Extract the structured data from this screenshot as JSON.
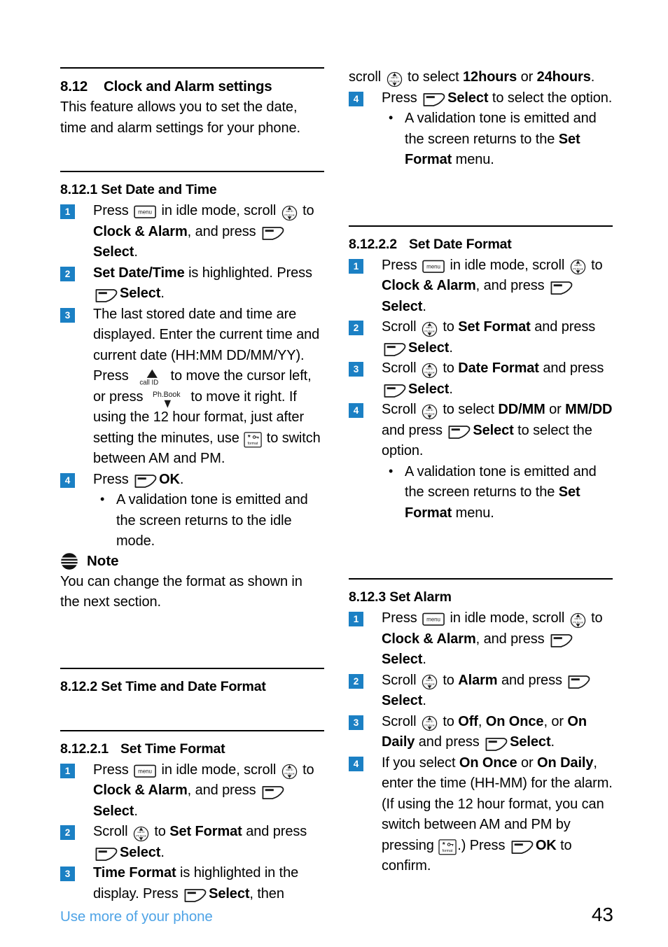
{
  "page": {
    "number": "43",
    "footer_text": "Use more of your phone"
  },
  "icons": {
    "menu_key": "menu-key-icon",
    "menu_key_label": "menu",
    "soft_key": "soft-key-icon",
    "nav_key": "navigation-key-icon",
    "nav_key_top_label": "call ID",
    "nav_key_bottom_label": "Ph.Book",
    "format_key": "format-key-icon",
    "format_key_label": "format",
    "callid_key": "call-id-key-icon",
    "callid_key_label": "call ID",
    "phbook_key": "phonebook-key-icon",
    "phbook_key_label": "Ph.Book",
    "note_icon": "note-icon"
  },
  "colors": {
    "badge_blue": "#1b80c4",
    "footer_blue": "#4ea3e6"
  },
  "left_column": {
    "section": {
      "number": "8.12",
      "title": "Clock and Alarm settings",
      "intro": "This feature allows you to set the date, time and alarm settings for your phone."
    },
    "sub1": {
      "number": "8.12.1",
      "title": "Set Date and Time",
      "steps": {
        "s1_a": "Press ",
        "s1_b": " in idle mode, scroll ",
        "s1_c": " to ",
        "s1_bold1": "Clock & Alarm",
        "s1_d": ", and press ",
        "s1_bold2": "Select",
        "s1_e": ".",
        "s2_bold1": "Set Date/Time",
        "s2_a": " is highlighted. Press ",
        "s2_bold2": "Select",
        "s2_b": ".",
        "s3_a": "The last stored date and time are displayed. Enter the current time and current date (HH:MM DD/MM/YY). Press ",
        "s3_b": " to move the cursor left, or press ",
        "s3_c": " to move it right. If using the 12 hour format, just after setting the minutes, use ",
        "s3_d": " to switch between AM and PM.",
        "s4_a": "Press ",
        "s4_bold": "OK",
        "s4_b": ".",
        "s4_bullet": "A validation tone is emitted and the screen returns to the idle mode."
      },
      "note": {
        "label": "Note",
        "text": "You can change the format as shown in the next section."
      }
    },
    "sub2": {
      "number": "8.12.2",
      "title": "Set Time and Date Format"
    },
    "sub2_1": {
      "number": "8.12.2.1",
      "title": "Set Time Format",
      "steps": {
        "s1_a": "Press ",
        "s1_b": " in idle mode, scroll ",
        "s1_c": " to ",
        "s1_bold1": "Clock & Alarm",
        "s1_d": ", and press ",
        "s1_bold2": "Select",
        "s1_e": ".",
        "s2_a": "Scroll ",
        "s2_b": " to ",
        "s2_bold1": "Set Format",
        "s2_c": " and press ",
        "s2_bold2": "Select",
        "s2_d": ".",
        "s3_bold1": "Time Format",
        "s3_a": " is highlighted in the display. Press ",
        "s3_bold2": "Select",
        "s3_b": ", then"
      }
    }
  },
  "right_column": {
    "continued": {
      "c_a": "scroll ",
      "c_b": " to select ",
      "c_bold1": "12hours",
      "c_c": " or ",
      "c_bold2": "24hours",
      "c_d": ".",
      "s4_a": "Press ",
      "s4_bold": "Select",
      "s4_b": " to select the option.",
      "s4_bullet_a": "A validation tone is emitted and the screen returns to the ",
      "s4_bullet_bold": "Set Format",
      "s4_bullet_b": " menu."
    },
    "sub2_2": {
      "number": "8.12.2.2",
      "title": "Set Date Format",
      "steps": {
        "s1_a": "Press ",
        "s1_b": " in idle mode, scroll ",
        "s1_c": " to ",
        "s1_bold1": "Clock & Alarm",
        "s1_d": ", and press ",
        "s1_bold2": "Select",
        "s1_e": ".",
        "s2_a": "Scroll ",
        "s2_b": " to ",
        "s2_bold1": "Set Format",
        "s2_c": " and press ",
        "s2_bold2": "Select",
        "s2_d": ".",
        "s3_a": "Scroll ",
        "s3_b": " to ",
        "s3_bold1": "Date Format",
        "s3_c": " and press ",
        "s3_bold2": "Select",
        "s3_d": ".",
        "s4_a": "Scroll ",
        "s4_b": " to select ",
        "s4_bold1": "DD/MM",
        "s4_c": " or ",
        "s4_bold2": "MM/DD",
        "s4_d": " and press ",
        "s4_bold3": "Select",
        "s4_e": " to select the option.",
        "s4_bullet_a": "A validation tone is emitted and the screen returns to the ",
        "s4_bullet_bold": "Set Format",
        "s4_bullet_b": " menu."
      }
    },
    "sub3": {
      "number": "8.12.3",
      "title": "Set Alarm",
      "steps": {
        "s1_a": "Press ",
        "s1_b": " in idle mode, scroll ",
        "s1_c": " to ",
        "s1_bold1": "Clock & Alarm",
        "s1_d": ", and press ",
        "s1_bold2": "Select",
        "s1_e": ".",
        "s2_a": "Scroll ",
        "s2_b": " to ",
        "s2_bold1": "Alarm",
        "s2_c": " and press ",
        "s2_bold2": "Select",
        "s2_d": ".",
        "s3_a": "Scroll ",
        "s3_b": " to ",
        "s3_bold1": "Off",
        "s3_c": ", ",
        "s3_bold2": "On Once",
        "s3_d": ", or ",
        "s3_bold3": "On Daily",
        "s3_e": " and press ",
        "s3_bold4": "Select",
        "s3_f": ".",
        "s4_a": "If you select ",
        "s4_bold1": "On Once",
        "s4_b": " or ",
        "s4_bold2": "On Daily",
        "s4_c": ", enter the time (HH-MM) for the alarm. (If using the 12 hour format, you can switch between AM and PM by pressing ",
        "s4_d": ".) Press ",
        "s4_bold3": "OK",
        "s4_e": " to confirm."
      }
    }
  }
}
